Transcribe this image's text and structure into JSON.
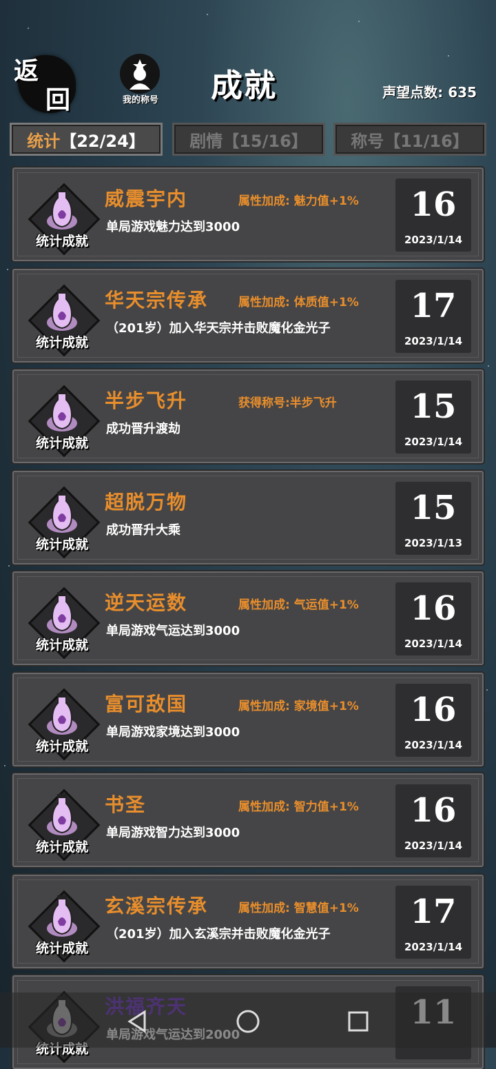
{
  "header": {
    "back_line1": "返",
    "back_line2": "回",
    "my_title_label": "我的称号",
    "title": "成就",
    "reputation_label": "声望点数:",
    "reputation_value": "635"
  },
  "tabs": [
    {
      "label": "统计",
      "count": "【22/24】",
      "active": true
    },
    {
      "label": "剧情",
      "count": "【15/16】",
      "active": false
    },
    {
      "label": "称号",
      "count": "【11/16】",
      "active": false
    }
  ],
  "badge_label": "统计成就",
  "achievements": [
    {
      "name": "威震宇内",
      "bonus": "属性加成: 魅力值+1%",
      "desc": "单局游戏魅力达到3000",
      "score": "16",
      "date": "2023/1/14"
    },
    {
      "name": "华天宗传承",
      "bonus": "属性加成: 体质值+1%",
      "desc": "（201岁）加入华天宗并击败魔化金光子",
      "score": "17",
      "date": "2023/1/14"
    },
    {
      "name": "半步飞升",
      "bonus": "获得称号:半步飞升",
      "desc": "成功晋升渡劫",
      "score": "15",
      "date": "2023/1/14"
    },
    {
      "name": "超脱万物",
      "bonus": "",
      "desc": "成功晋升大乘",
      "score": "15",
      "date": "2023/1/13"
    },
    {
      "name": "逆天运数",
      "bonus": "属性加成: 气运值+1%",
      "desc": "单局游戏气运达到3000",
      "score": "16",
      "date": "2023/1/14"
    },
    {
      "name": "富可敌国",
      "bonus": "属性加成: 家境值+1%",
      "desc": "单局游戏家境达到3000",
      "score": "16",
      "date": "2023/1/14"
    },
    {
      "name": "书圣",
      "bonus": "属性加成: 智力值+1%",
      "desc": "单局游戏智力达到3000",
      "score": "16",
      "date": "2023/1/14"
    },
    {
      "name": "玄溪宗传承",
      "bonus": "属性加成: 智慧值+1%",
      "desc": "（201岁）加入玄溪宗并击败魔化金光子",
      "score": "17",
      "date": "2023/1/14"
    },
    {
      "name": "洪福齐天",
      "bonus": "",
      "desc": "单局游戏气运达到2000",
      "score": "11",
      "date": ""
    }
  ],
  "colors": {
    "accent_orange": "#e88e2c",
    "locked_purple": "#7b3fcf",
    "card_bg": "#454547"
  }
}
